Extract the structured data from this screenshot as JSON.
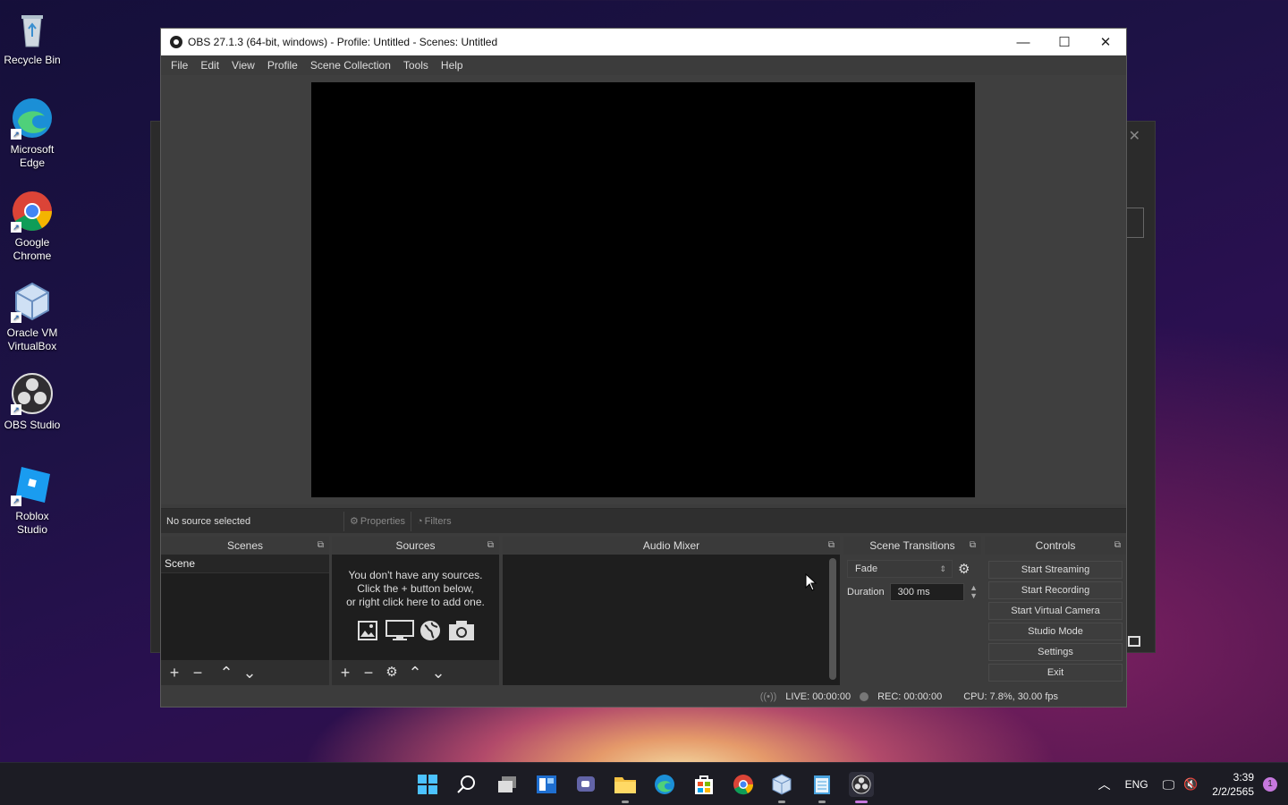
{
  "desktop": {
    "icons": [
      {
        "label": "Recycle Bin",
        "icon": "recycle-bin-icon"
      },
      {
        "label": "Microsoft Edge",
        "icon": "edge-icon"
      },
      {
        "label": "Google Chrome",
        "icon": "chrome-icon"
      },
      {
        "label": "Oracle VM VirtualBox",
        "icon": "virtualbox-icon"
      },
      {
        "label": "OBS Studio",
        "icon": "obs-icon"
      },
      {
        "label": "Roblox Studio",
        "icon": "roblox-studio-icon"
      }
    ]
  },
  "window": {
    "title": "OBS 27.1.3 (64-bit, windows) - Profile: Untitled - Scenes: Untitled",
    "menu": [
      "File",
      "Edit",
      "View",
      "Profile",
      "Scene Collection",
      "Tools",
      "Help"
    ]
  },
  "source_toolbar": {
    "no_source": "No source selected",
    "properties": "Properties",
    "filters": "Filters"
  },
  "docks": {
    "scenes": {
      "title": "Scenes",
      "items": [
        "Scene"
      ]
    },
    "sources": {
      "title": "Sources",
      "empty_line1": "You don't have any sources.",
      "empty_line2": "Click the + button below,",
      "empty_line3": "or right click here to add one."
    },
    "audio_mixer": {
      "title": "Audio Mixer"
    },
    "scene_transitions": {
      "title": "Scene Transitions",
      "transition": "Fade",
      "duration_label": "Duration",
      "duration_value": "300 ms"
    },
    "controls": {
      "title": "Controls",
      "buttons": [
        "Start Streaming",
        "Start Recording",
        "Start Virtual Camera",
        "Studio Mode",
        "Settings",
        "Exit"
      ]
    }
  },
  "status": {
    "live": "LIVE: 00:00:00",
    "rec": "REC: 00:00:00",
    "cpu": "CPU: 7.8%, 30.00 fps"
  },
  "taskbar": {
    "apps": [
      "start-icon",
      "search-icon",
      "task-view-icon",
      "widgets-icon",
      "chat-icon",
      "file-explorer-icon",
      "edge-icon",
      "store-icon",
      "chrome-icon",
      "virtualbox-icon",
      "notepad-icon",
      "obs-icon"
    ],
    "language": "ENG",
    "time": "3:39",
    "date": "2/2/2565",
    "notifications": "1"
  },
  "colors": {
    "obs_bg": "#3c3c3c",
    "dock_bg": "#2a2a2a",
    "preview_bg": "#000000",
    "taskbar_bg": "#1c1c24"
  }
}
